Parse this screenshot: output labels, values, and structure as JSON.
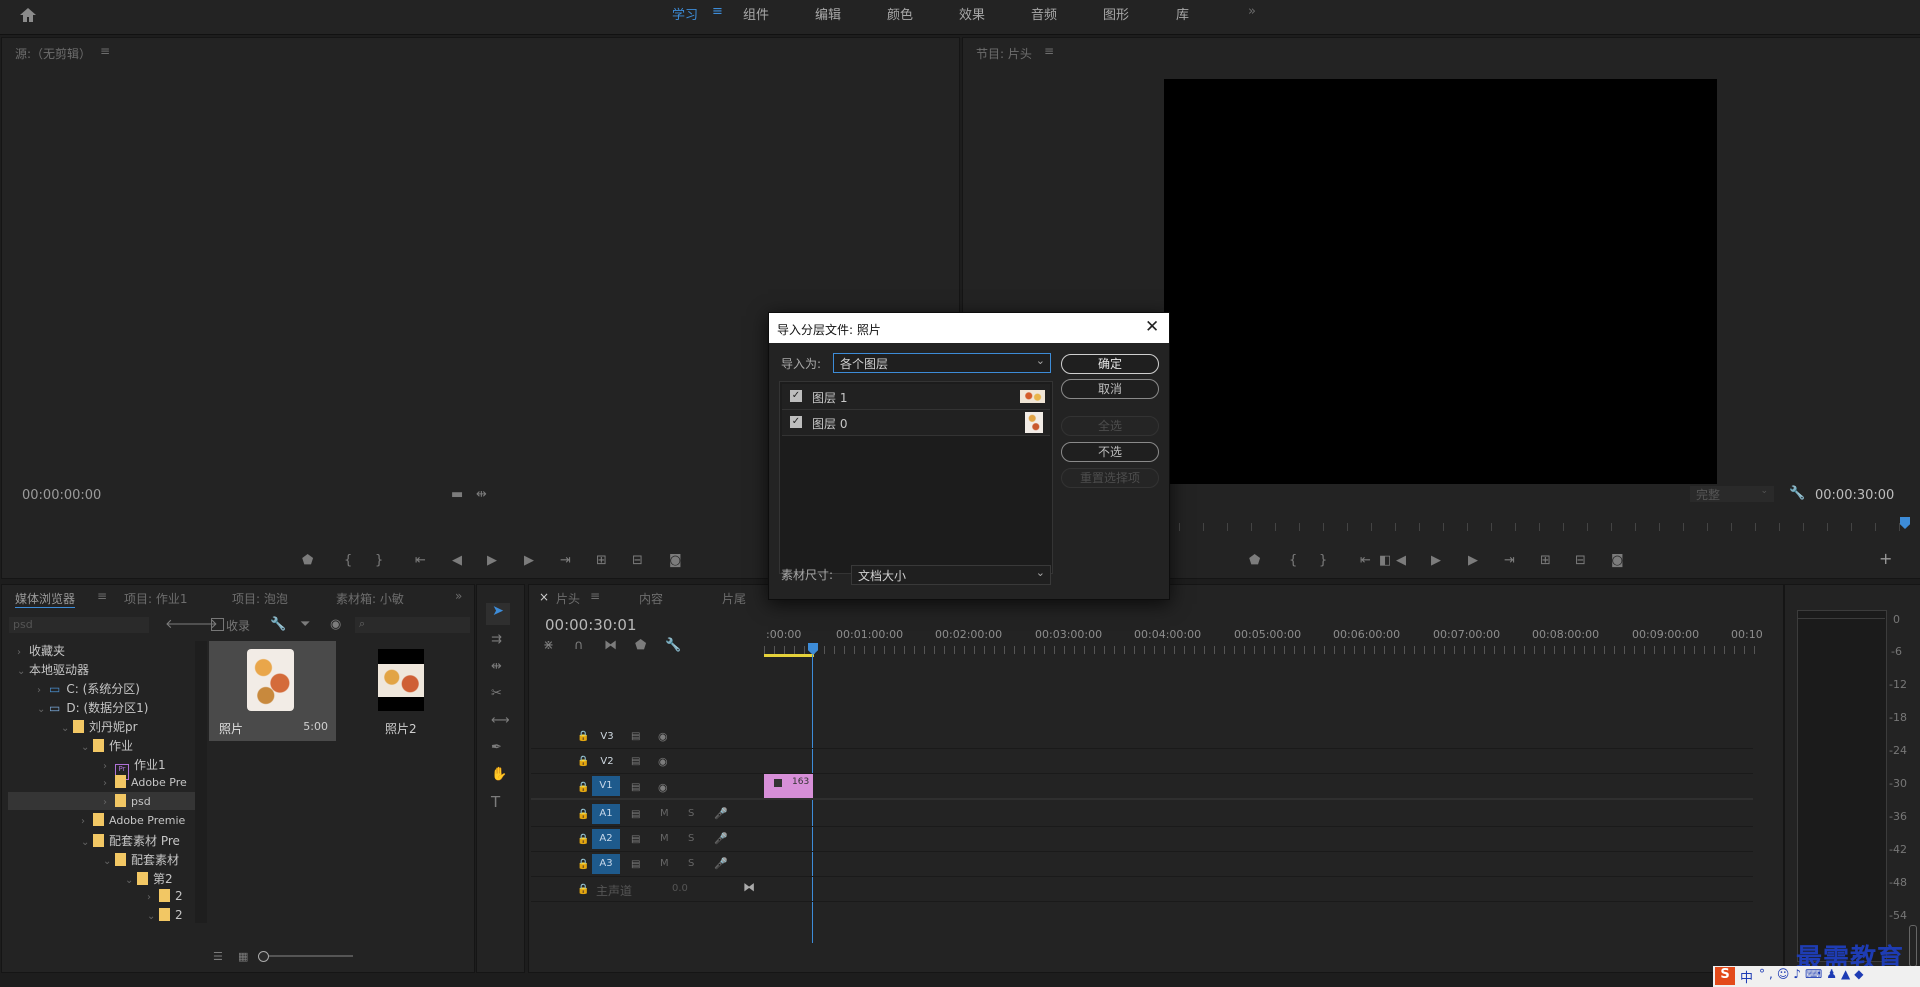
{
  "workspace_tabs": [
    "学习",
    "组件",
    "编辑",
    "颜色",
    "效果",
    "音频",
    "图形",
    "库"
  ],
  "more_glyph": "»",
  "source": {
    "title": "源:（无剪辑）",
    "timecode": "00:00:00:00"
  },
  "program": {
    "title": "节目: 片头",
    "fit_label": "完整",
    "timecode": "00:00:30:00"
  },
  "left_panel_tabs": {
    "media_browser": "媒体浏览器",
    "project": "项目: 作业1",
    "project2": "项目: 泡泡",
    "bin": "素材箱: 小敏"
  },
  "media_browser": {
    "path_value": "psd",
    "ingest_label": "收录"
  },
  "tree": {
    "favorites": "收藏夹",
    "local_drives": "本地驱动器",
    "drive_c": "C: (系统分区)",
    "drive_d": "D: (数据分区1)",
    "folder_user": "刘丹妮pr",
    "folder_homework": "作业",
    "item_homework1": "作业1",
    "item_adobe_pre": "Adobe Pre",
    "item_psd": "psd",
    "item_adobe_premie": "Adobe Premie",
    "item_materials": "配套素材 Pre",
    "item_materials2": "配套素材",
    "item_ch2": "第2",
    "item_sub1": "2",
    "item_sub2": "2"
  },
  "thumbnails": [
    {
      "name": "照片",
      "duration": "5:00"
    },
    {
      "name": "照片2",
      "duration": ""
    }
  ],
  "timeline": {
    "tabs": {
      "close": "×",
      "sequence": "片头",
      "content": "内容",
      "title3": "片尾"
    },
    "timecode": "00:00:30:01",
    "ruler": [
      ":00:00",
      "00:01:00:00",
      "00:02:00:00",
      "00:03:00:00",
      "00:04:00:00",
      "00:05:00:00",
      "00:06:00:00",
      "00:07:00:00",
      "00:08:00:00",
      "00:09:00:00",
      "00:10"
    ],
    "video_tracks": [
      "V3",
      "V2",
      "V1"
    ],
    "audio_tracks": [
      "A1",
      "A2",
      "A3"
    ],
    "audio_mute": "M",
    "audio_solo": "S",
    "master": {
      "label": "主声道",
      "value": "0.0"
    },
    "clip_label": "163"
  },
  "audio_meter_scale": [
    "0",
    "-6",
    "-12",
    "-18",
    "-24",
    "-30",
    "-36",
    "-42",
    "-48",
    "-54"
  ],
  "dialog": {
    "title": "导入分层文件: 照片",
    "import_as_label": "导入为:",
    "import_as_value": "各个图层",
    "layers": [
      {
        "name": "图层 1",
        "checked": true
      },
      {
        "name": "图层 0",
        "checked": true
      }
    ],
    "buttons": {
      "ok": "确定",
      "cancel": "取消",
      "select_all": "全选",
      "select_none": "不选",
      "reset": "重置选择项"
    },
    "footage_size_label": "素材尺寸:",
    "footage_size_value": "文档大小"
  },
  "watermark": "最需教育",
  "ime_label": "中",
  "colors": {
    "accent": "#3d8cd8",
    "clip": "#d78fd8",
    "folder": "#f2c764",
    "track_blue": "#1e5a8c"
  }
}
